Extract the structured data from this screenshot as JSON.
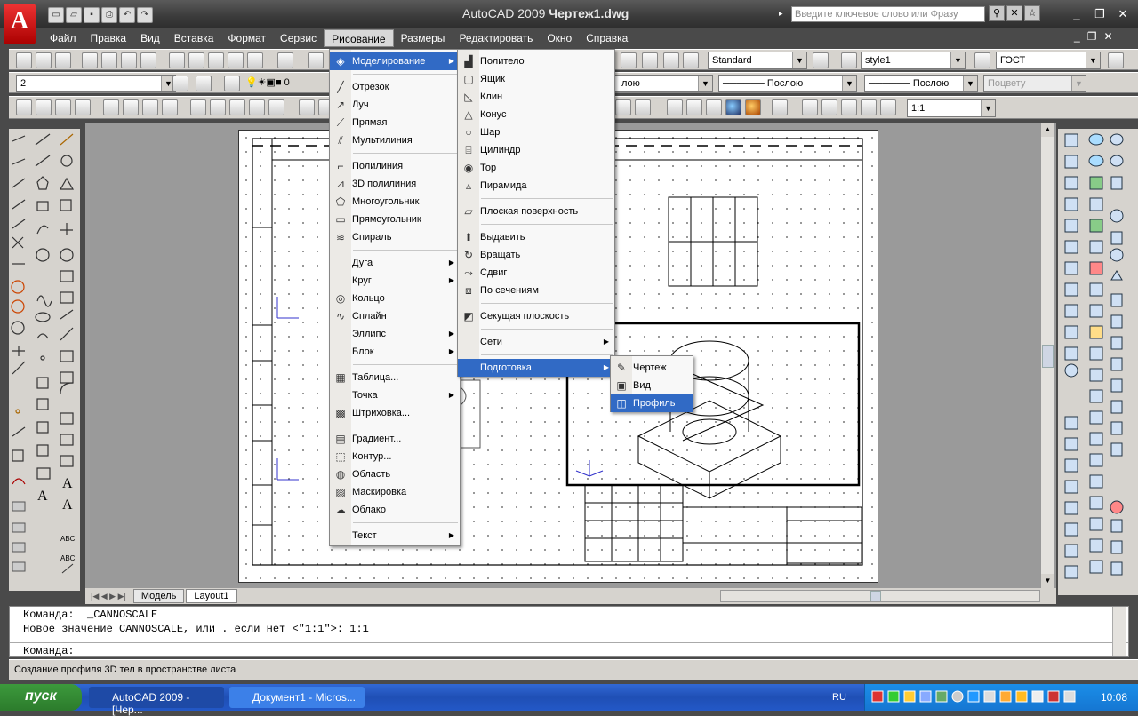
{
  "app": {
    "title": "AutoCAD 2009",
    "doc": "Чертеж1.dwg",
    "logo": "A",
    "search_placeholder": "Введите ключевое слово или Фразу"
  },
  "menubar": [
    {
      "label": "Файл"
    },
    {
      "label": "Правка"
    },
    {
      "label": "Вид"
    },
    {
      "label": "Вставка"
    },
    {
      "label": "Формат"
    },
    {
      "label": "Сервис"
    },
    {
      "label": "Рисование"
    },
    {
      "label": "Размеры"
    },
    {
      "label": "Редактировать"
    },
    {
      "label": "Окно"
    },
    {
      "label": "Справка"
    }
  ],
  "toolbar": {
    "textstyle": "Standard",
    "dimstyle": "style1",
    "tablestyle": "ГОСТ",
    "layer": "2",
    "linetype": "Послою",
    "lineweight": "Послою",
    "plotstyle": "Поцвету",
    "scale": "1:1",
    "layer_color_label": "0"
  },
  "draw_menu": [
    {
      "label": "Моделирование",
      "icon": "modeling-icon",
      "sub": true,
      "hl": true
    },
    {
      "sep": true
    },
    {
      "label": "Отрезок",
      "icon": "line-icon"
    },
    {
      "label": "Луч",
      "icon": "ray-icon"
    },
    {
      "label": "Прямая",
      "icon": "xline-icon"
    },
    {
      "label": "Мультилиния",
      "icon": "mline-icon"
    },
    {
      "sep": true
    },
    {
      "label": "Полилиния",
      "icon": "polyline-icon"
    },
    {
      "label": "3D полилиния",
      "icon": "3dpoly-icon"
    },
    {
      "label": "Многоугольник",
      "icon": "polygon-icon"
    },
    {
      "label": "Прямоугольник",
      "icon": "rectangle-icon"
    },
    {
      "label": "Спираль",
      "icon": "helix-icon"
    },
    {
      "sep": true
    },
    {
      "label": "Дуга",
      "sub": true
    },
    {
      "label": "Круг",
      "sub": true
    },
    {
      "label": "Кольцо",
      "icon": "donut-icon"
    },
    {
      "label": "Сплайн",
      "icon": "spline-icon"
    },
    {
      "label": "Эллипс",
      "sub": true
    },
    {
      "label": "Блок",
      "sub": true
    },
    {
      "sep": true
    },
    {
      "label": "Таблица...",
      "icon": "table-icon"
    },
    {
      "label": "Точка",
      "sub": true
    },
    {
      "label": "Штриховка...",
      "icon": "hatch-icon"
    },
    {
      "sep": true
    },
    {
      "label": "Градиент...",
      "icon": "gradient-icon"
    },
    {
      "label": "Контур...",
      "icon": "boundary-icon"
    },
    {
      "label": "Область",
      "icon": "region-icon"
    },
    {
      "label": "Маскировка",
      "icon": "wipeout-icon"
    },
    {
      "label": "Облако",
      "icon": "revcloud-icon"
    },
    {
      "sep": true
    },
    {
      "label": "Текст",
      "sub": true
    }
  ],
  "modeling_menu": [
    {
      "label": "Политело",
      "icon": "polysolid-icon"
    },
    {
      "label": "Ящик",
      "icon": "box-icon"
    },
    {
      "label": "Клин",
      "icon": "wedge-icon"
    },
    {
      "label": "Конус",
      "icon": "cone-icon"
    },
    {
      "label": "Шар",
      "icon": "sphere-icon"
    },
    {
      "label": "Цилиндр",
      "icon": "cylinder-icon"
    },
    {
      "label": "Тор",
      "icon": "torus-icon"
    },
    {
      "label": "Пирамида",
      "icon": "pyramid-icon"
    },
    {
      "sep": true
    },
    {
      "label": "Плоская поверхность",
      "icon": "planesurf-icon"
    },
    {
      "sep": true
    },
    {
      "label": "Выдавить",
      "icon": "extrude-icon"
    },
    {
      "label": "Вращать",
      "icon": "revolve-icon"
    },
    {
      "label": "Сдвиг",
      "icon": "sweep-icon"
    },
    {
      "label": "По сечениям",
      "icon": "loft-icon"
    },
    {
      "sep": true
    },
    {
      "label": "Секущая плоскость",
      "icon": "sectionplane-icon"
    },
    {
      "sep": true
    },
    {
      "label": "Сети",
      "sub": true
    },
    {
      "sep": true
    },
    {
      "label": "Подготовка",
      "sub": true,
      "hl": true
    }
  ],
  "setup_menu": [
    {
      "label": "Чертеж",
      "icon": "soldraw-icon"
    },
    {
      "label": "Вид",
      "icon": "solview-icon"
    },
    {
      "label": "Профиль",
      "icon": "solprof-icon",
      "hl": true
    }
  ],
  "layout_tabs": [
    {
      "label": "Модель"
    },
    {
      "label": "Layout1"
    }
  ],
  "command": {
    "line1": "Команда:  _CANNOSCALE",
    "line2": "Новое значение CANNOSCALE, или . если нет <\"1:1\">: 1:1",
    "prompt": "Команда:"
  },
  "status": "Создание профиля 3D тел в пространстве листа",
  "taskbar": {
    "start": "пуск",
    "tasks": [
      {
        "label": "AutoCAD 2009 - [Чер..."
      },
      {
        "label": "Документ1 - Micros..."
      }
    ],
    "lang": "RU",
    "clock": "10:08"
  }
}
